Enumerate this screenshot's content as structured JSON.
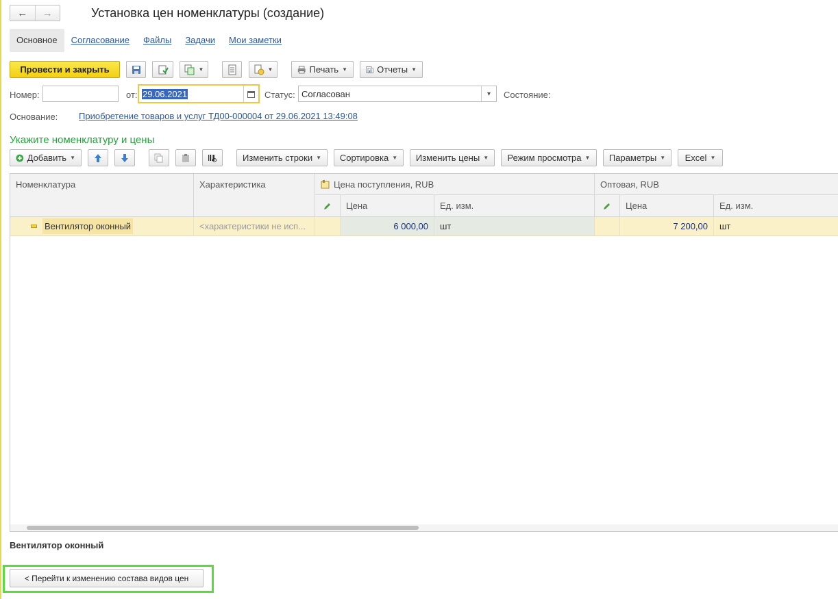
{
  "window": {
    "title": "Установка цен номенклатуры (создание)",
    "nav_back": "←",
    "nav_forward": "→"
  },
  "tabs": [
    {
      "label": "Основное",
      "active": true
    },
    {
      "label": "Согласование"
    },
    {
      "label": "Файлы"
    },
    {
      "label": "Задачи"
    },
    {
      "label": "Мои заметки"
    }
  ],
  "toolbar": {
    "post_close": "Провести и закрыть",
    "print": "Печать",
    "reports": "Отчеты"
  },
  "form": {
    "number_label": "Номер:",
    "number_value": "",
    "date_label": "от:",
    "date_value": "29.06.2021",
    "status_label": "Статус:",
    "status_value": "Согласован",
    "state_label": "Состояние:",
    "basis_label": "Основание:",
    "basis_link": "Приобретение товаров и услуг ТД00-000004 от 29.06.2021 13:49:08"
  },
  "section_title": "Укажите номенклатуру и цены",
  "table_toolbar": {
    "add": "Добавить",
    "change_rows": "Изменить строки",
    "sorting": "Сортировка",
    "change_prices": "Изменить цены",
    "view_mode": "Режим просмотра",
    "parameters": "Параметры",
    "excel": "Excel"
  },
  "table": {
    "headers": {
      "nomenclature": "Номенклатура",
      "characteristic": "Характеристика",
      "group1": "Цена поступления, RUB",
      "group2": "Оптовая, RUB",
      "price": "Цена",
      "unit": "Ед. изм."
    },
    "rows": [
      {
        "nomenclature": "Вентилятор оконный",
        "characteristic": "<характеристики не исп...",
        "price1": "6 000,00",
        "unit1": "шт",
        "price2": "7 200,00",
        "unit2": "шт"
      }
    ]
  },
  "footer": {
    "selected_name": "Вентилятор оконный",
    "back_button": "< Перейти к изменению состава видов цен"
  },
  "colors": {
    "accent_yellow": "#f2cf12",
    "link_blue": "#2a57a6",
    "section_green": "#23a33a",
    "highlight_green": "#5bdb3b",
    "row_selected": "#fbf1c8"
  }
}
